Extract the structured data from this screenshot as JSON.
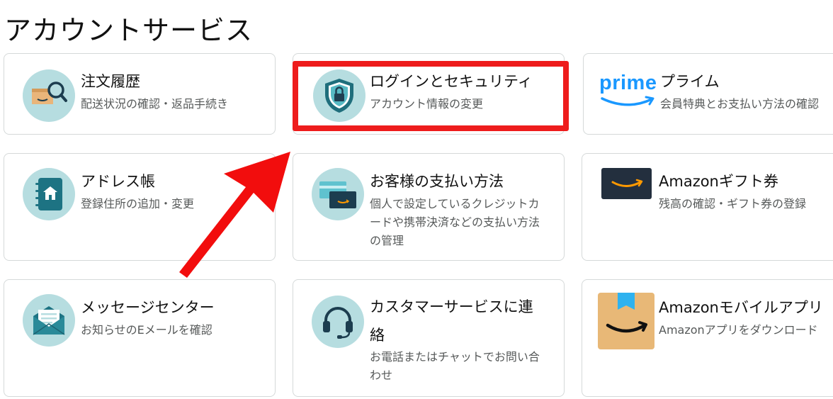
{
  "page": {
    "title": "アカウントサービス"
  },
  "cards": {
    "orders": {
      "title": "注文履歴",
      "desc": "配送状況の確認・返品手続き",
      "icon": "package-search-icon"
    },
    "security": {
      "title": "ログインとセキュリティ",
      "desc": "アカウント情報の変更",
      "icon": "shield-lock-icon"
    },
    "prime": {
      "title": "プライム",
      "desc": "会員特典とお支払い方法の確認",
      "logo_text": "prime",
      "icon": "prime-logo-icon"
    },
    "address": {
      "title": "アドレス帳",
      "desc": "登録住所の追加・変更",
      "icon": "address-book-icon"
    },
    "payment": {
      "title": "お客様の支払い方法",
      "desc": "個人で設定しているクレジットカードや携帯決済などの支払い方法の管理",
      "icon": "payment-cards-icon"
    },
    "giftcard": {
      "title": "Amazonギフト券",
      "desc": "残高の確認・ギフト券の登録",
      "icon": "gift-card-icon"
    },
    "messages": {
      "title": "メッセージセンター",
      "desc": "お知らせのEメールを確認",
      "icon": "envelope-icon"
    },
    "support": {
      "title": "カスタマーサービスに連絡",
      "desc": "お電話またはチャットでお問い合わせ",
      "icon": "headset-icon"
    },
    "mobile": {
      "title": "Amazonモバイルアプリ",
      "desc": "Amazonアプリをダウンロード",
      "icon": "amazon-app-icon"
    }
  },
  "colors": {
    "highlight": "#ee1c1c",
    "icon_bg": "#b6dde0",
    "icon_dark": "#1c6b78",
    "smile": "#ff9900",
    "prime_blue": "#1a98ff"
  }
}
